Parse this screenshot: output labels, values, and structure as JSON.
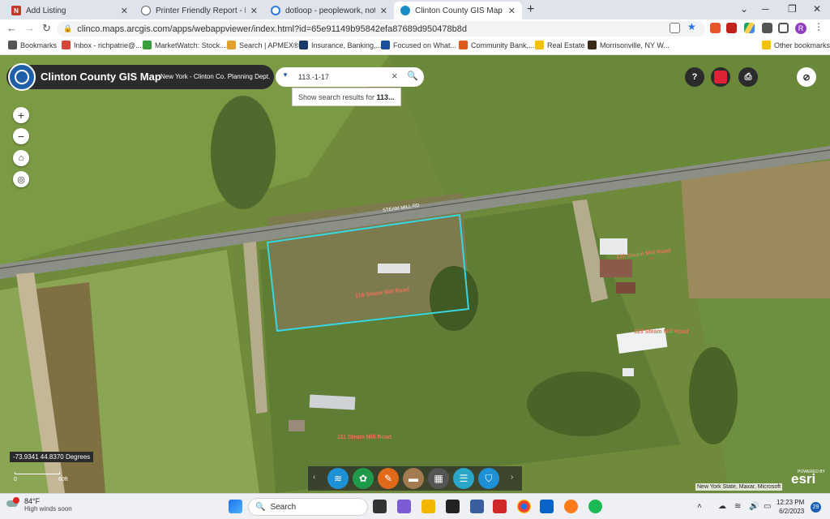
{
  "browser": {
    "tabs": [
      {
        "title": "Add Listing",
        "favicon_color": "#c0392b",
        "favicon_letter": "N"
      },
      {
        "title": "Printer Friendly Report - Image M",
        "favicon_color": "#555555",
        "favicon_letter": ""
      },
      {
        "title": "dotloop - peoplework, not paper",
        "favicon_color": "#2a7ae2",
        "favicon_letter": ""
      },
      {
        "title": "Clinton County GIS Map",
        "favicon_color": "#1a8fc7",
        "favicon_letter": ""
      }
    ],
    "new_tab": "+",
    "url": "clinco.maps.arcgis.com/apps/webappviewer/index.html?id=65e91149b95842efa87689d950478b8d",
    "profile_letter": "R",
    "bookmarks": [
      {
        "label": "Bookmarks",
        "color": "#555555"
      },
      {
        "label": "Inbox - richpatrie@...",
        "color": "#d44638"
      },
      {
        "label": "MarketWatch: Stock...",
        "color": "#3a9e3a"
      },
      {
        "label": "Search | APMEX®",
        "color": "#e0a030"
      },
      {
        "label": "Insurance, Banking,...",
        "color": "#1a3a6a"
      },
      {
        "label": "Focused on What...",
        "color": "#1a4fa0"
      },
      {
        "label": "Community Bank,...",
        "color": "#e05a1a"
      },
      {
        "label": "Real Estate",
        "color": "#f2c200"
      },
      {
        "label": "Morrisonville, NY W...",
        "color": "#3a2a1a"
      },
      {
        "label": "Other bookmarks",
        "color": "#f2c200"
      }
    ]
  },
  "app": {
    "title": "Clinton County GIS Map",
    "subtitle": "New York - Clinton Co. Planning Dept.",
    "search_value": "113.-1-17",
    "suggest_prefix": "Show search results for ",
    "suggest_term": "113...",
    "help_label": "?",
    "parcel_labels": [
      "116 Steam Mill Road",
      "121 Steam Mill Road",
      "123 Steam Mill Road",
      "111 Steam Mill Road"
    ],
    "road_label": "STEAM MILL RD",
    "coords": "-73.9341 44.8370 Degrees",
    "scale_left": "0",
    "scale_right": "60ft",
    "attribution": "New York State, Maxar, Microsoft",
    "esri_powered": "POWERED BY",
    "esri": "esri"
  },
  "taskbar": {
    "temp": "84°F",
    "weather_desc": "High winds soon",
    "search_label": "Search",
    "time": "12:23 PM",
    "date": "6/2/2023",
    "notifications": "29"
  }
}
